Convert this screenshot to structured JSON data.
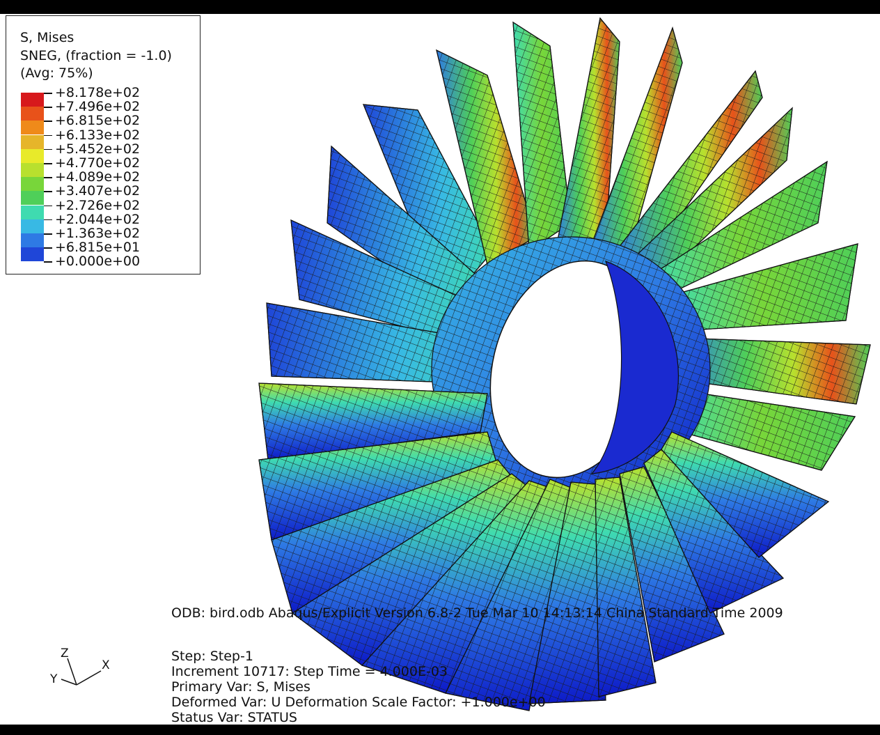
{
  "legend": {
    "title": "S, Mises",
    "subtitle": "SNEG, (fraction = -1.0)",
    "avg": "(Avg: 75%)",
    "values": [
      "+8.178e+02",
      "+7.496e+02",
      "+6.815e+02",
      "+6.133e+02",
      "+5.452e+02",
      "+4.770e+02",
      "+4.089e+02",
      "+3.407e+02",
      "+2.726e+02",
      "+2.044e+02",
      "+1.363e+02",
      "+6.815e+01",
      "+0.000e+00"
    ],
    "colors": [
      "#d7191c",
      "#e8521a",
      "#ef8a1a",
      "#e6b52a",
      "#e8ea2a",
      "#b8e02e",
      "#78d63a",
      "#4fcf59",
      "#3fdbb0",
      "#38b9e4",
      "#2e7ae4",
      "#1f46d8",
      "#0d10c8"
    ]
  },
  "info": {
    "odb_line": "ODB: bird.odb    Abaqus/Explicit Version 6.8-2    Tue Mar 10 14:13:14 China Standard Time 2009",
    "step": "Step: Step-1",
    "increment": "Increment     10717: Step Time =    4.000E-03",
    "primary_var": "Primary Var: S, Mises",
    "deformed_var": "Deformed Var: U   Deformation Scale Factor: +1.000e+00",
    "status_var": "Status Var: STATUS"
  },
  "triad": {
    "x": "X",
    "y": "Y",
    "z": "Z"
  }
}
